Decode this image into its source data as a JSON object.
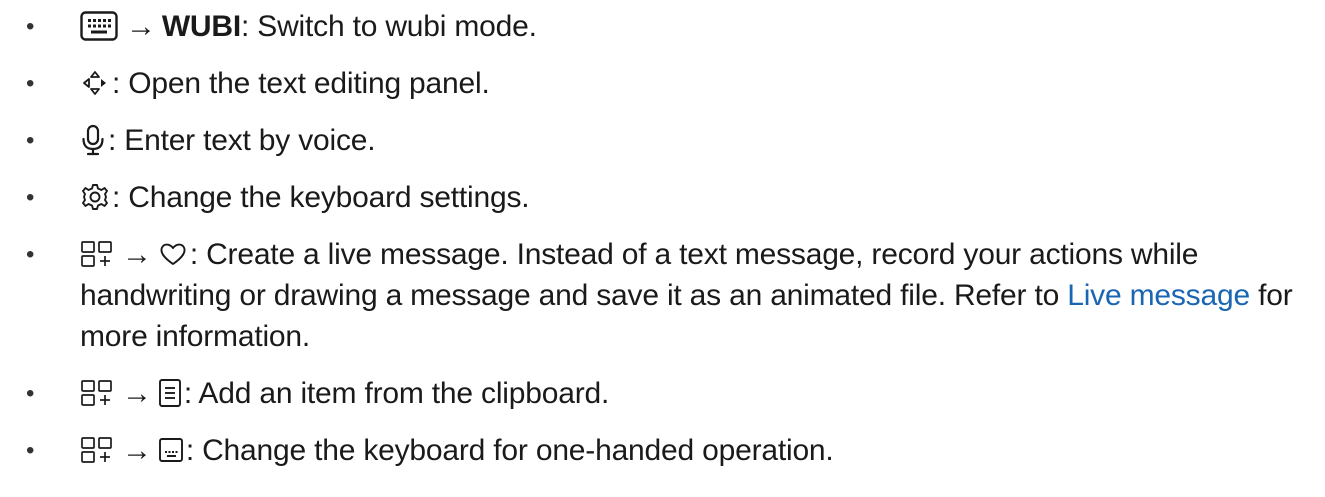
{
  "items": [
    {
      "icons": [
        "keyboard-icon"
      ],
      "arrow": "→",
      "bold": "WUBI",
      "text": ": Switch to wubi mode."
    },
    {
      "icons": [
        "text-edit-arrows-icon"
      ],
      "text": ": Open the text editing panel."
    },
    {
      "icons": [
        "microphone-icon"
      ],
      "text": ": Enter text by voice."
    },
    {
      "icons": [
        "gear-icon"
      ],
      "text": ": Change the keyboard settings."
    },
    {
      "icons": [
        "more-options-icon",
        "heart-icon"
      ],
      "arrow": "→",
      "text_before_link": ": Create a live message. Instead of a text message, record your actions while handwriting or drawing a message and save it as an animated file. Refer to",
      "link": "Live message",
      "text_after_link": "for more information."
    },
    {
      "icons": [
        "more-options-icon",
        "clipboard-icon"
      ],
      "arrow": "→",
      "text": ": Add an item from the clipboard."
    },
    {
      "icons": [
        "more-options-icon",
        "one-handed-keyboard-icon"
      ],
      "arrow": "→",
      "text": ": Change the keyboard for one-handed operation."
    }
  ],
  "bullet": "•",
  "colors": {
    "link": "#1a66b3",
    "text": "#1a1a1a"
  }
}
